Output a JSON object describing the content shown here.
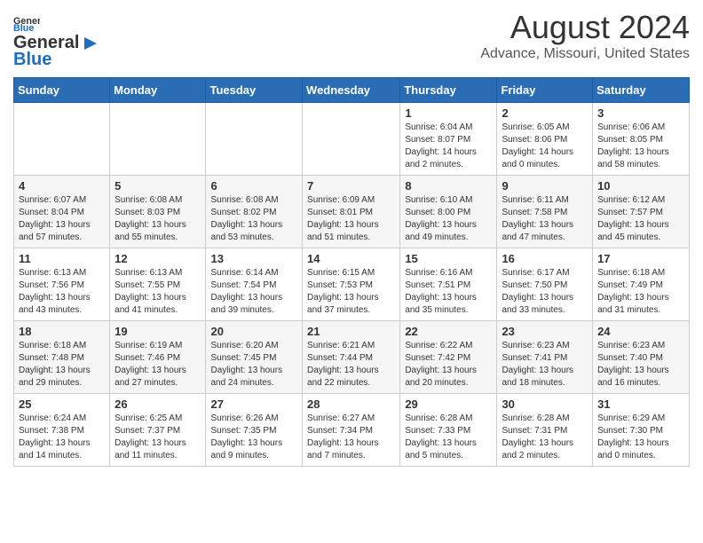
{
  "header": {
    "logo_general": "General",
    "logo_blue": "Blue",
    "title": "August 2024",
    "subtitle": "Advance, Missouri, United States"
  },
  "days_of_week": [
    "Sunday",
    "Monday",
    "Tuesday",
    "Wednesday",
    "Thursday",
    "Friday",
    "Saturday"
  ],
  "weeks": [
    [
      {
        "num": "",
        "info": ""
      },
      {
        "num": "",
        "info": ""
      },
      {
        "num": "",
        "info": ""
      },
      {
        "num": "",
        "info": ""
      },
      {
        "num": "1",
        "info": "Sunrise: 6:04 AM\nSunset: 8:07 PM\nDaylight: 14 hours\nand 2 minutes."
      },
      {
        "num": "2",
        "info": "Sunrise: 6:05 AM\nSunset: 8:06 PM\nDaylight: 14 hours\nand 0 minutes."
      },
      {
        "num": "3",
        "info": "Sunrise: 6:06 AM\nSunset: 8:05 PM\nDaylight: 13 hours\nand 58 minutes."
      }
    ],
    [
      {
        "num": "4",
        "info": "Sunrise: 6:07 AM\nSunset: 8:04 PM\nDaylight: 13 hours\nand 57 minutes."
      },
      {
        "num": "5",
        "info": "Sunrise: 6:08 AM\nSunset: 8:03 PM\nDaylight: 13 hours\nand 55 minutes."
      },
      {
        "num": "6",
        "info": "Sunrise: 6:08 AM\nSunset: 8:02 PM\nDaylight: 13 hours\nand 53 minutes."
      },
      {
        "num": "7",
        "info": "Sunrise: 6:09 AM\nSunset: 8:01 PM\nDaylight: 13 hours\nand 51 minutes."
      },
      {
        "num": "8",
        "info": "Sunrise: 6:10 AM\nSunset: 8:00 PM\nDaylight: 13 hours\nand 49 minutes."
      },
      {
        "num": "9",
        "info": "Sunrise: 6:11 AM\nSunset: 7:58 PM\nDaylight: 13 hours\nand 47 minutes."
      },
      {
        "num": "10",
        "info": "Sunrise: 6:12 AM\nSunset: 7:57 PM\nDaylight: 13 hours\nand 45 minutes."
      }
    ],
    [
      {
        "num": "11",
        "info": "Sunrise: 6:13 AM\nSunset: 7:56 PM\nDaylight: 13 hours\nand 43 minutes."
      },
      {
        "num": "12",
        "info": "Sunrise: 6:13 AM\nSunset: 7:55 PM\nDaylight: 13 hours\nand 41 minutes."
      },
      {
        "num": "13",
        "info": "Sunrise: 6:14 AM\nSunset: 7:54 PM\nDaylight: 13 hours\nand 39 minutes."
      },
      {
        "num": "14",
        "info": "Sunrise: 6:15 AM\nSunset: 7:53 PM\nDaylight: 13 hours\nand 37 minutes."
      },
      {
        "num": "15",
        "info": "Sunrise: 6:16 AM\nSunset: 7:51 PM\nDaylight: 13 hours\nand 35 minutes."
      },
      {
        "num": "16",
        "info": "Sunrise: 6:17 AM\nSunset: 7:50 PM\nDaylight: 13 hours\nand 33 minutes."
      },
      {
        "num": "17",
        "info": "Sunrise: 6:18 AM\nSunset: 7:49 PM\nDaylight: 13 hours\nand 31 minutes."
      }
    ],
    [
      {
        "num": "18",
        "info": "Sunrise: 6:18 AM\nSunset: 7:48 PM\nDaylight: 13 hours\nand 29 minutes."
      },
      {
        "num": "19",
        "info": "Sunrise: 6:19 AM\nSunset: 7:46 PM\nDaylight: 13 hours\nand 27 minutes."
      },
      {
        "num": "20",
        "info": "Sunrise: 6:20 AM\nSunset: 7:45 PM\nDaylight: 13 hours\nand 24 minutes."
      },
      {
        "num": "21",
        "info": "Sunrise: 6:21 AM\nSunset: 7:44 PM\nDaylight: 13 hours\nand 22 minutes."
      },
      {
        "num": "22",
        "info": "Sunrise: 6:22 AM\nSunset: 7:42 PM\nDaylight: 13 hours\nand 20 minutes."
      },
      {
        "num": "23",
        "info": "Sunrise: 6:23 AM\nSunset: 7:41 PM\nDaylight: 13 hours\nand 18 minutes."
      },
      {
        "num": "24",
        "info": "Sunrise: 6:23 AM\nSunset: 7:40 PM\nDaylight: 13 hours\nand 16 minutes."
      }
    ],
    [
      {
        "num": "25",
        "info": "Sunrise: 6:24 AM\nSunset: 7:38 PM\nDaylight: 13 hours\nand 14 minutes."
      },
      {
        "num": "26",
        "info": "Sunrise: 6:25 AM\nSunset: 7:37 PM\nDaylight: 13 hours\nand 11 minutes."
      },
      {
        "num": "27",
        "info": "Sunrise: 6:26 AM\nSunset: 7:35 PM\nDaylight: 13 hours\nand 9 minutes."
      },
      {
        "num": "28",
        "info": "Sunrise: 6:27 AM\nSunset: 7:34 PM\nDaylight: 13 hours\nand 7 minutes."
      },
      {
        "num": "29",
        "info": "Sunrise: 6:28 AM\nSunset: 7:33 PM\nDaylight: 13 hours\nand 5 minutes."
      },
      {
        "num": "30",
        "info": "Sunrise: 6:28 AM\nSunset: 7:31 PM\nDaylight: 13 hours\nand 2 minutes."
      },
      {
        "num": "31",
        "info": "Sunrise: 6:29 AM\nSunset: 7:30 PM\nDaylight: 13 hours\nand 0 minutes."
      }
    ]
  ]
}
